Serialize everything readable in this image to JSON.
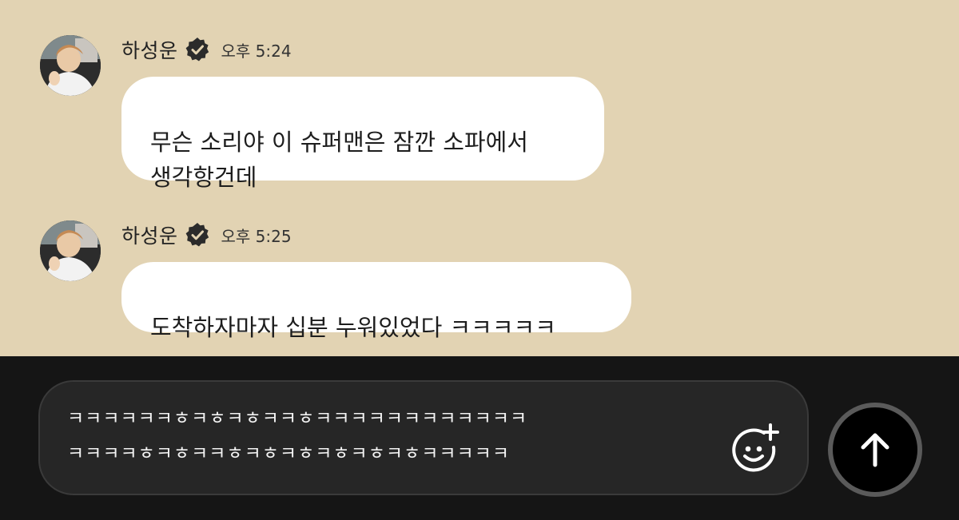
{
  "messages": [
    {
      "sender": "하성운",
      "time": "오후 5:24",
      "text": "무슨 소리야 이 슈퍼맨은 잠깐 소파에서\n생각항건데"
    },
    {
      "sender": "하성운",
      "time": "오후 5:25",
      "text": "도착하자마자 십분 누워있었다 ㅋㅋㅋㅋㅋ"
    }
  ],
  "composer": {
    "value": "ㅋㅋㅋㅋㅋㅋㅎㅋㅎㅋㅎㅋㅋㅎㅋㅋㅋㅋㅋㅋㅋㅋㅋㅋㅋㅋ\nㅋㅋㅋㅋㅎㅋㅎㅋㅋㅎㅋㅎㅋㅎㅋㅎㅋㅎㅋㅎㅋㅋㅋㅋㅋ"
  },
  "icons": {
    "verified": "verified-badge-icon",
    "emoji": "add-emoji-icon",
    "send": "arrow-up-icon"
  },
  "colors": {
    "chat_background": "#e2d3b3",
    "bubble": "#ffffff",
    "bottom_bar": "#151515",
    "input_background": "#262626",
    "send_button": "#000000"
  }
}
